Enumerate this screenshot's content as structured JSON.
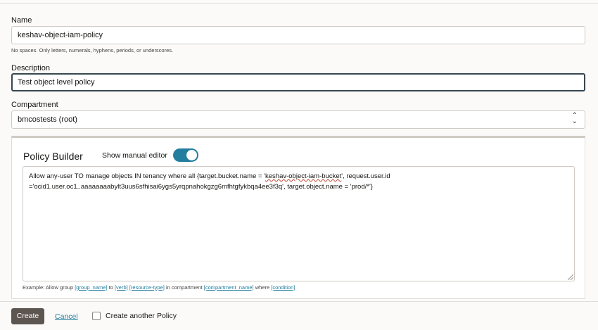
{
  "name": {
    "label": "Name",
    "value": "keshav-object-iam-policy",
    "hint": "No spaces. Only letters, numerals, hyphens, periods, or underscores."
  },
  "description": {
    "label": "Description",
    "value": "Test object level policy"
  },
  "compartment": {
    "label": "Compartment",
    "value": "bmcostests (root)"
  },
  "policy_builder": {
    "title": "Policy Builder",
    "toggle_label": "Show manual editor",
    "toggle_on": true,
    "statement_pre": "Allow any-user TO manage objects IN tenancy where all {target.bucket.name = '",
    "statement_bucket": "keshav-object-iam-bucket",
    "statement_post": "', request.user.id ='ocid1.user.oc1..aaaaaaaabylt3uus6sfhisai6ygs5yrqpnahokgzg6mfhtgfykbqa4ee3f3q', target.object.name = 'prod/*'}",
    "example": {
      "prefix": "Example: Allow group",
      "group": "[group_name]",
      "to": "to",
      "verb": "[verb]",
      "resource": "[resource-type]",
      "in": "in compartment",
      "compartment": "[compartment_name]",
      "where": "where",
      "condition": "[condition]"
    }
  },
  "footer": {
    "create": "Create",
    "cancel": "Cancel",
    "another": "Create another Policy"
  }
}
